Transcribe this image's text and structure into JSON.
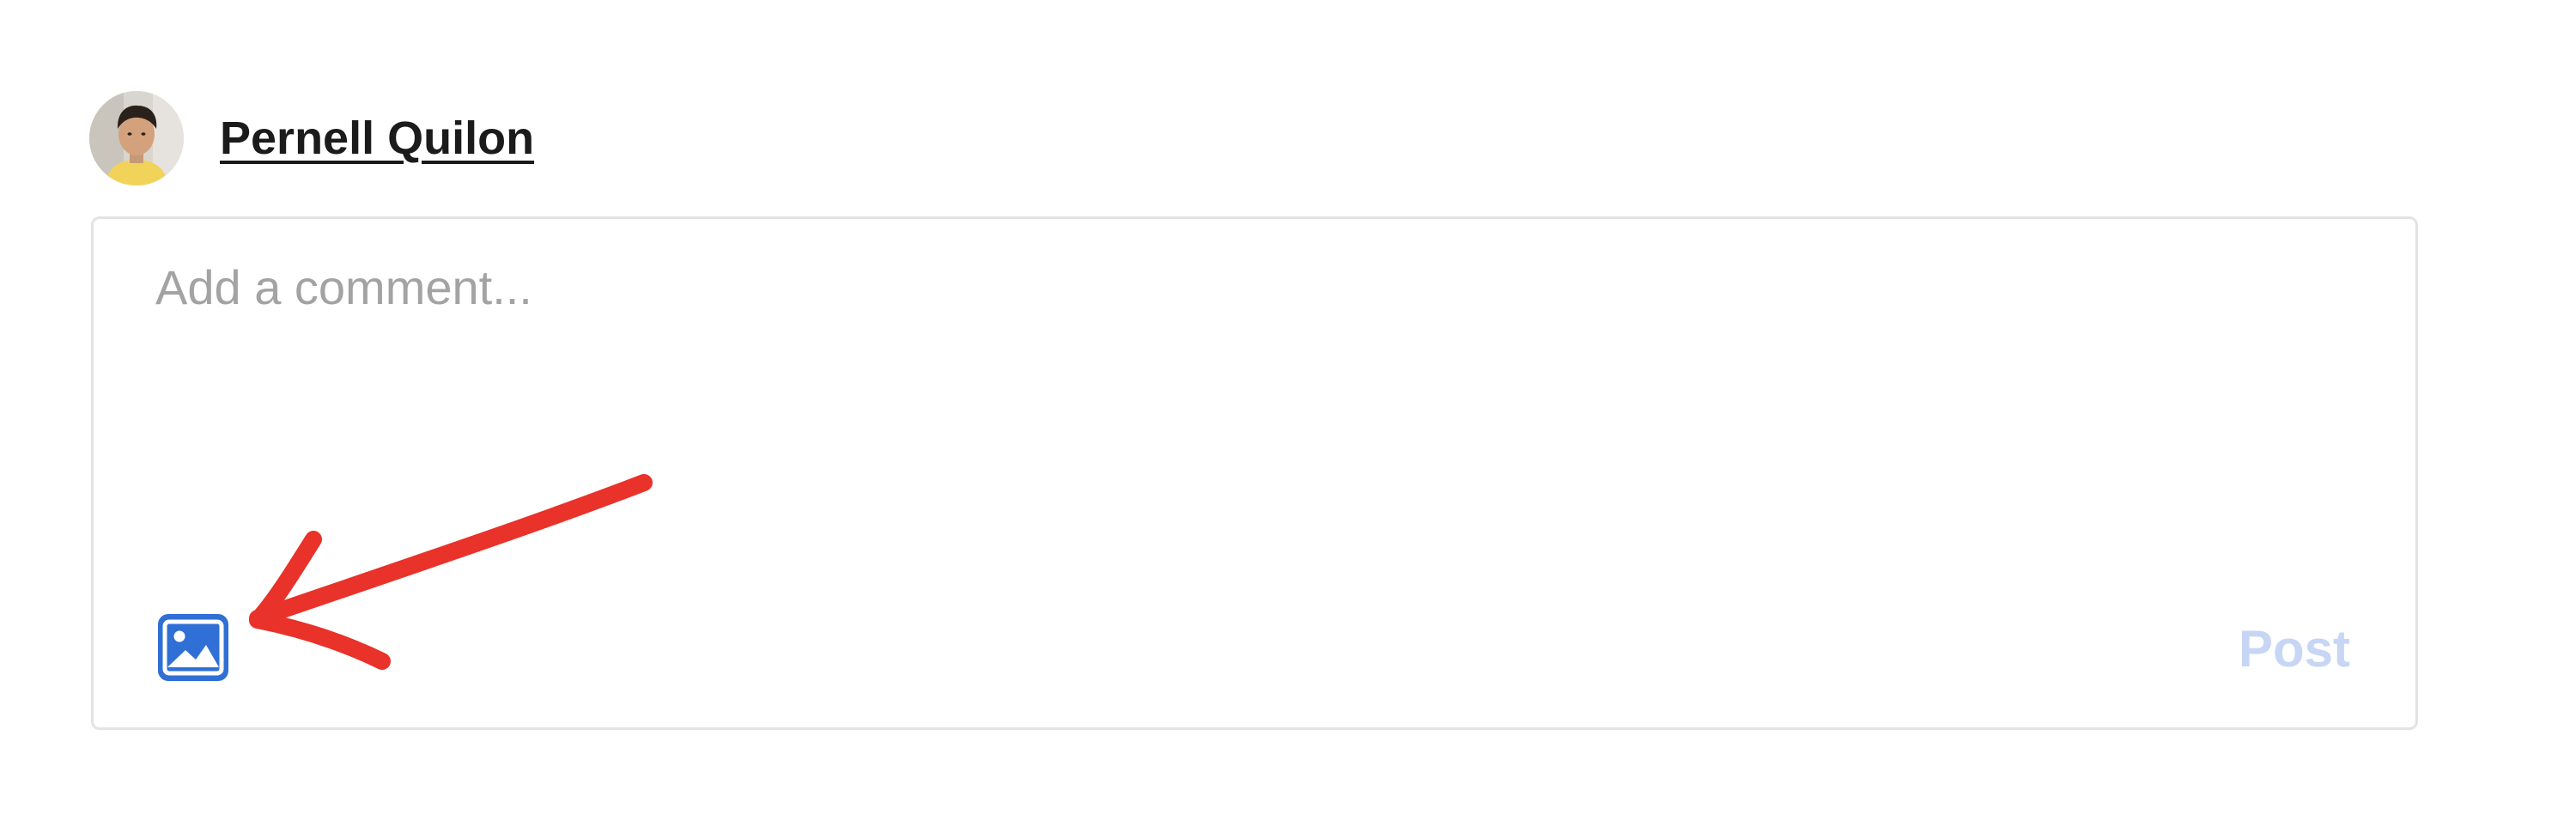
{
  "author": {
    "name": "Pernell Quilon"
  },
  "comment": {
    "placeholder": "Add a comment...",
    "value": ""
  },
  "toolbar": {
    "image_icon": "image-icon",
    "post_label": "Post"
  },
  "colors": {
    "accent": "#2f6fd6",
    "post_disabled": "#c6d6f4",
    "annotation": "#e8322a",
    "border": "#e3e3e3",
    "placeholder": "#a3a3a3"
  }
}
